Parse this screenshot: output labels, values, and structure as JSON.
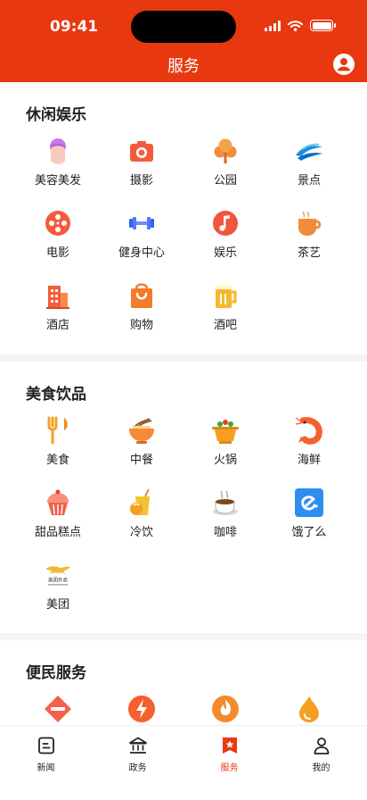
{
  "status_bar": {
    "time": "09:41"
  },
  "header": {
    "title": "服务"
  },
  "sections": [
    {
      "title": "休闲娱乐",
      "items": [
        {
          "label": "美容美发",
          "icon": "beauty-icon"
        },
        {
          "label": "摄影",
          "icon": "camera-icon"
        },
        {
          "label": "公园",
          "icon": "park-icon"
        },
        {
          "label": "景点",
          "icon": "scenic-icon"
        },
        {
          "label": "电影",
          "icon": "film-reel-icon"
        },
        {
          "label": "健身中心",
          "icon": "dumbbell-icon"
        },
        {
          "label": "娱乐",
          "icon": "music-icon"
        },
        {
          "label": "茶艺",
          "icon": "tea-cup-icon"
        },
        {
          "label": "酒店",
          "icon": "hotel-icon"
        },
        {
          "label": "购物",
          "icon": "shopping-bag-icon"
        },
        {
          "label": "酒吧",
          "icon": "beer-icon"
        }
      ]
    },
    {
      "title": "美食饮品",
      "items": [
        {
          "label": "美食",
          "icon": "fork-knife-icon"
        },
        {
          "label": "中餐",
          "icon": "noodle-bowl-icon"
        },
        {
          "label": "火锅",
          "icon": "hotpot-icon"
        },
        {
          "label": "海鲜",
          "icon": "shrimp-icon"
        },
        {
          "label": "甜品糕点",
          "icon": "cupcake-icon"
        },
        {
          "label": "冷饮",
          "icon": "cold-drink-icon"
        },
        {
          "label": "咖啡",
          "icon": "coffee-icon"
        },
        {
          "label": "饿了么",
          "icon": "eleme-logo-icon"
        },
        {
          "label": "美团",
          "icon": "meituan-logo-icon",
          "logo_text": "美团外卖"
        }
      ]
    },
    {
      "title": "便民服务",
      "items": [
        {
          "icon": "no-entry-icon"
        },
        {
          "icon": "lightning-icon"
        },
        {
          "icon": "flame-icon"
        },
        {
          "icon": "water-drop-icon"
        }
      ]
    }
  ],
  "tabbar": [
    {
      "label": "新闻",
      "icon": "news-icon",
      "active": false
    },
    {
      "label": "政务",
      "icon": "government-icon",
      "active": false
    },
    {
      "label": "服务",
      "icon": "service-icon",
      "active": true
    },
    {
      "label": "我的",
      "icon": "profile-icon",
      "active": false
    }
  ],
  "colors": {
    "primary": "#e8380f",
    "text": "#222222",
    "background": "#f4f4f4"
  }
}
